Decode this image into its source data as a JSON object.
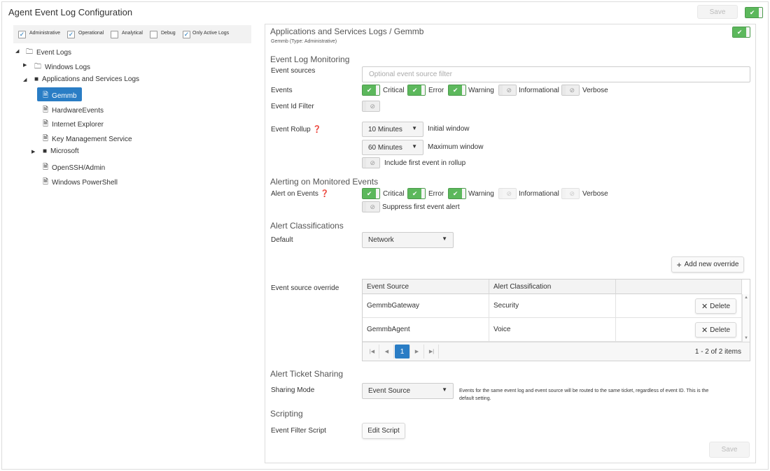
{
  "header": {
    "title": "Agent Event Log Configuration",
    "save_label": "Save"
  },
  "filters": [
    {
      "label": "Administrative",
      "checked": true
    },
    {
      "label": "Operational",
      "checked": true
    },
    {
      "label": "Analytical",
      "checked": false
    },
    {
      "label": "Debug",
      "checked": false
    },
    {
      "label": "Only Active Logs",
      "checked": true
    }
  ],
  "tree": {
    "root": "Event Logs",
    "windows_logs": "Windows Logs",
    "apps_services": "Applications and Services Logs",
    "items": [
      "Gemmb",
      "HardwareEvents",
      "Internet Explorer",
      "Key Management Service",
      "Microsoft",
      "OpenSSH/Admin",
      "Windows PowerShell"
    ]
  },
  "panel": {
    "title": "Applications and Services Logs / Gemmb",
    "subtitle": "Gemmb (Type: Administrative)",
    "monitoring": {
      "heading": "Event Log Monitoring",
      "sources_label": "Event sources",
      "sources_placeholder": "Optional event source filter",
      "events_label": "Events",
      "event_id_label": "Event Id Filter"
    },
    "levels": [
      "Critical",
      "Error",
      "Warning",
      "Informational",
      "Verbose"
    ],
    "rollup": {
      "label": "Event Rollup",
      "initial_value": "10 Minutes",
      "initial_label": "Initial window",
      "max_value": "60 Minutes",
      "max_label": "Maximum window",
      "include_label": "Include first event in rollup"
    },
    "alerting": {
      "heading": "Alerting on Monitored Events",
      "label": "Alert on Events",
      "suppress_label": "Suppress first event alert"
    },
    "classifications": {
      "heading": "Alert Classifications",
      "default_label": "Default",
      "default_value": "Network",
      "add_label": "Add new override",
      "override_label": "Event source override",
      "columns": [
        "Event Source",
        "Alert Classification"
      ],
      "rows": [
        {
          "source": "GemmbGateway",
          "classification": "Security"
        },
        {
          "source": "GemmbAgent",
          "classification": "Voice"
        }
      ],
      "delete_label": "Delete",
      "page": "1",
      "page_info": "1 - 2 of 2 items"
    },
    "ticket": {
      "heading": "Alert Ticket Sharing",
      "mode_label": "Sharing Mode",
      "mode_value": "Event Source",
      "note": "Events for the same event log and event source will be routed to the same ticket, regardless of event ID. This is the default setting."
    },
    "scripting": {
      "heading": "Scripting",
      "label": "Event Filter Script",
      "edit_label": "Edit Script"
    },
    "save_label": "Save"
  },
  "colors": {
    "accent": "#2a7dc5",
    "toggle_on": "#5cb85c"
  }
}
